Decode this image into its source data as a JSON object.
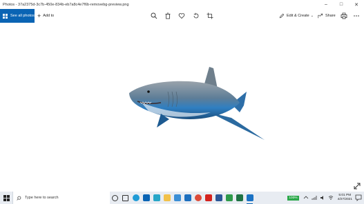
{
  "window": {
    "title": "Photos - 37a2375d-3c7b-450e-834b-eb7a8c4e7f6b-removebg-preview.png",
    "controls": [
      "minimize-icon",
      "maximize-icon",
      "close-icon"
    ]
  },
  "toolbar": {
    "see_all_label": "See all photos",
    "add_to_label": "Add to",
    "center_icons": [
      "zoom-icon",
      "delete-icon",
      "favorite-icon",
      "rotate-icon",
      "crop-icon"
    ],
    "edit_create_label": "Edit & Create",
    "share_label": "Share",
    "right_icons": [
      "print-icon",
      "more-icon"
    ]
  },
  "taskbar": {
    "search_placeholder": "Type here to search",
    "battery_label": "100%",
    "time": "5:01 PM",
    "date": "4/27/2021"
  },
  "colors": {
    "accent": "#0a64b4",
    "taskbar_bg": "#e8ecf2"
  }
}
